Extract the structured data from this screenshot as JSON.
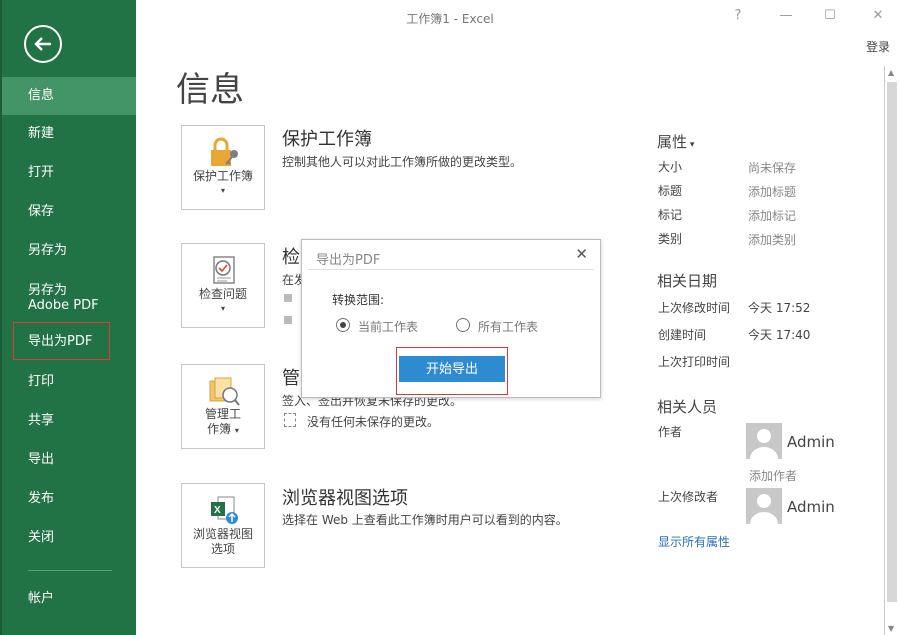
{
  "window": {
    "title": "工作簿1 - Excel",
    "help": "?",
    "minimize": "—",
    "restore": "☐",
    "close": "✕",
    "login": "登录"
  },
  "sidebar": {
    "items": [
      {
        "label": "信息"
      },
      {
        "label": "新建"
      },
      {
        "label": "打开"
      },
      {
        "label": "保存"
      },
      {
        "label": "另存为"
      },
      {
        "label": "另存为 Adobe PDF"
      },
      {
        "label": "导出为PDF"
      },
      {
        "label": "打印"
      },
      {
        "label": "共享"
      },
      {
        "label": "导出"
      },
      {
        "label": "发布"
      },
      {
        "label": "关闭"
      },
      {
        "label": "帐户"
      }
    ],
    "active_index": 0,
    "bg_color": "#217346"
  },
  "main": {
    "title": "信息",
    "sections": [
      {
        "button_label": "保护工作簿",
        "title": "保护工作簿",
        "desc": "控制其他人可以对此工作簿所做的更改类型。"
      },
      {
        "button_label": "检查问题",
        "title": "检",
        "desc": "在发"
      },
      {
        "button_label_line1": "管理工",
        "button_label_line2": "作簿",
        "title": "管",
        "desc": "签入、签出并恢复未保存的更改。",
        "sub_item": "没有任何未保存的更改。"
      },
      {
        "button_label_line1": "浏览器视图",
        "button_label_line2": "选项",
        "title": "浏览器视图选项",
        "desc": "选择在 Web 上查看此工作簿时用户可以看到的内容。"
      }
    ]
  },
  "properties": {
    "heading": "属性",
    "rows": [
      {
        "label": "大小",
        "value": "尚未保存"
      },
      {
        "label": "标题",
        "value": "添加标题"
      },
      {
        "label": "标记",
        "value": "添加标记"
      },
      {
        "label": "类别",
        "value": "添加类别"
      }
    ],
    "dates_heading": "相关日期",
    "dates": [
      {
        "label": "上次修改时间",
        "value": "今天 17:52"
      },
      {
        "label": "创建时间",
        "value": "今天 17:40"
      },
      {
        "label": "上次打印时间",
        "value": ""
      }
    ],
    "people_heading": "相关人员",
    "author_label": "作者",
    "author_name": "Admin",
    "add_author": "添加作者",
    "last_modified_by_label": "上次修改者",
    "last_modified_by_name": "Admin",
    "show_all": "显示所有属性"
  },
  "dialog": {
    "title": "导出为PDF",
    "close": "✕",
    "range_label": "转换范围:",
    "options": [
      {
        "label": "当前工作表",
        "checked": true
      },
      {
        "label": "所有工作表",
        "checked": false
      }
    ],
    "start_button": "开始导出",
    "accent_color": "#2d8bd0"
  }
}
